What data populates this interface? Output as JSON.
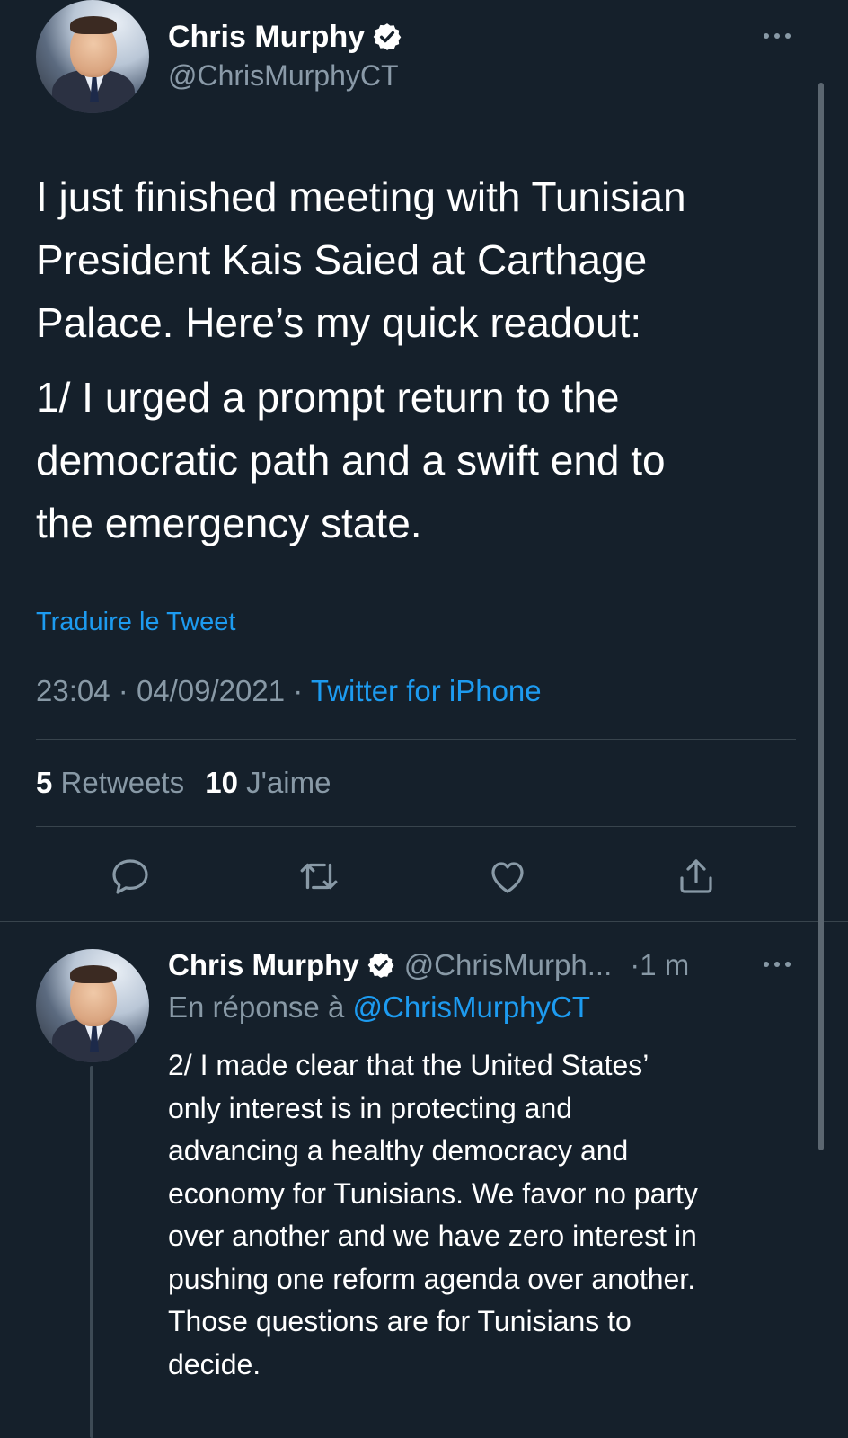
{
  "main_tweet": {
    "author_name": "Chris Murphy",
    "author_handle": "@ChrisMurphyCT",
    "paragraph_1": [
      "I just finished meeting with Tunisian",
      "President Kais Saied at Carthage",
      "Palace. Here’s my quick readout:"
    ],
    "paragraph_2": [
      "1/ I urged a prompt return to the",
      "democratic path and a swift end to",
      "the emergency state."
    ],
    "translate_label": "Traduire le Tweet",
    "time": "23:04",
    "date": "04/09/2021",
    "separator": "·",
    "source": "Twitter for iPhone",
    "retweets_count": "5",
    "retweets_label": "Retweets",
    "likes_count": "10",
    "likes_label": "J'aime"
  },
  "reply_tweet": {
    "author_name": "Chris Murphy",
    "author_handle": "@ChrisMurph...",
    "time_ago": "·1 m",
    "reply_prefix": "En réponse à",
    "reply_to": "@ChrisMurphyCT",
    "lines": [
      "2/ I made clear that the United States’",
      "only interest is in protecting and",
      "advancing a healthy democracy and",
      "economy for Tunisians. We favor no party",
      "over another and we have zero interest in",
      "pushing one reform agenda over another.",
      "Those questions are for Tunisians to",
      "decide."
    ]
  },
  "icons": {
    "more": "more-icon",
    "verified": "verified-badge-icon",
    "reply": "reply-icon",
    "retweet": "retweet-icon",
    "like": "heart-icon",
    "share": "share-icon"
  },
  "colors": {
    "background": "#15202b",
    "text": "#ffffff",
    "muted": "#8899a6",
    "link": "#1d9bf0",
    "divider": "#38444d"
  }
}
